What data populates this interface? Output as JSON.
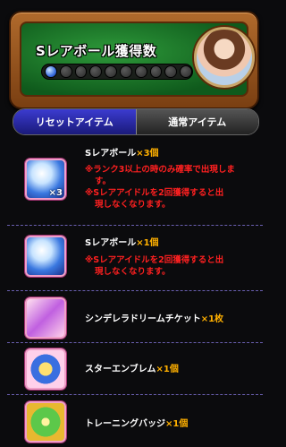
{
  "header": {
    "title": "Sレアボール獲得数",
    "ball_total": 10,
    "ball_filled": 1
  },
  "tabs": [
    {
      "label": "リセットアイテム",
      "active": true
    },
    {
      "label": "通常アイテム",
      "active": false
    }
  ],
  "items": [
    {
      "name": "Sレアボール",
      "count_label": "×3個",
      "icon": "s-rare-ball-icon",
      "icon_badge": "×3",
      "notes": [
        {
          "line1": "※ランク3以上の時のみ確率で出現しま",
          "line2": "す。"
        },
        {
          "line1": "※Sレアアイドルを2回獲得すると出",
          "line2": "現しなくなります。"
        }
      ]
    },
    {
      "name": "Sレアボール",
      "count_label": "×1個",
      "icon": "s-rare-ball-icon",
      "notes": [
        {
          "line1": "※Sレアアイドルを2回獲得すると出",
          "line2": "現しなくなります。"
        }
      ]
    },
    {
      "name": "シンデレラドリームチケット",
      "count_label": "×1枚",
      "icon": "dream-ticket-icon"
    },
    {
      "name": "スターエンブレム",
      "count_label": "×1個",
      "icon": "star-emblem-icon"
    },
    {
      "name": "トレーニングバッジ",
      "count_label": "×1個",
      "icon": "training-badge-icon"
    }
  ]
}
